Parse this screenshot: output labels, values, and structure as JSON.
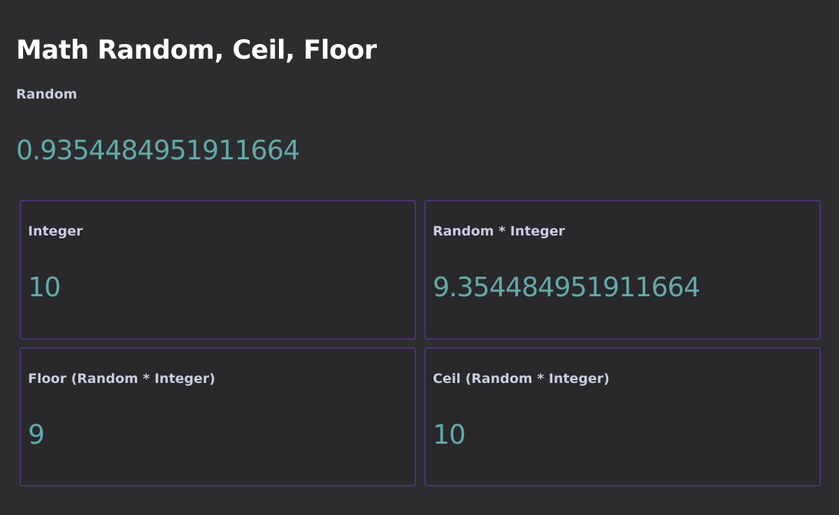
{
  "page": {
    "title": "Math Random, Ceil, Floor"
  },
  "random": {
    "label": "Random",
    "value": "0.9354484951911664"
  },
  "cards": [
    {
      "label": "Integer",
      "value": "10"
    },
    {
      "label": "Random * Integer",
      "value": "9.354484951911664"
    },
    {
      "label": "Floor (Random * Integer)",
      "value": "9"
    },
    {
      "label": "Ceil (Random * Integer)",
      "value": "10"
    }
  ],
  "colors": {
    "background": "#2d2d2f",
    "card_background": "#29282b",
    "card_border": "#4c3478",
    "value_text": "#62aaab",
    "label_text": "#c9cde0",
    "title_text": "#ffffff"
  }
}
